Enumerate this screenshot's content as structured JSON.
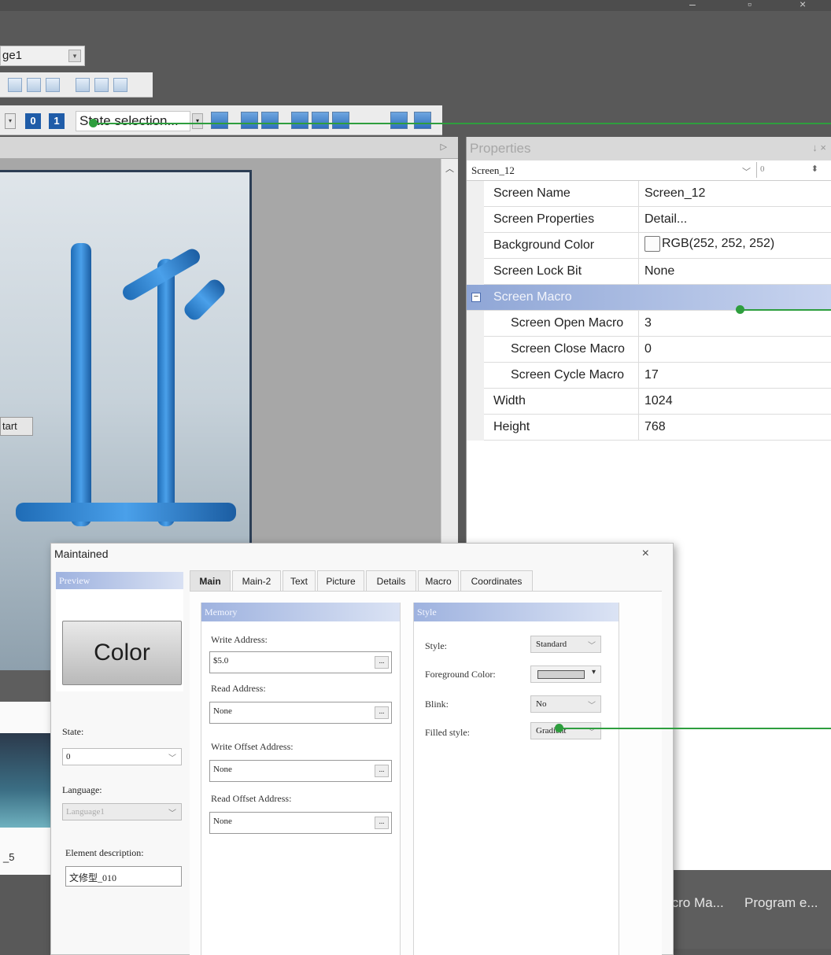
{
  "toolbar": {
    "page_combo_value": "ge1",
    "bit0_label": "0",
    "bit1_label": "1",
    "state_selection_text": "State selection..."
  },
  "canvas": {
    "start_button_label": "tart"
  },
  "thumbnail": {
    "label": "_5"
  },
  "properties": {
    "title": "Properties",
    "pin_icons": "↓ ×",
    "selector_value": "Screen_12",
    "selector_index": "0",
    "rows": [
      {
        "name": "Screen Name",
        "value": "Screen_12"
      },
      {
        "name": "Screen Properties",
        "value": "Detail..."
      },
      {
        "name": "Background Color",
        "value": "RGB(252, 252, 252)"
      },
      {
        "name": "Screen Lock Bit",
        "value": "None"
      }
    ],
    "category": {
      "name": "Screen Macro",
      "toggle": "−"
    },
    "macro_rows": [
      {
        "name": "Screen Open Macro",
        "value": "3"
      },
      {
        "name": "Screen Close Macro",
        "value": "0"
      },
      {
        "name": "Screen Cycle Macro",
        "value": "17"
      }
    ],
    "size_rows": [
      {
        "name": "Width",
        "value": "1024"
      },
      {
        "name": "Height",
        "value": "768"
      }
    ]
  },
  "bottom_tabs": [
    "Macro Ma...",
    "Program e..."
  ],
  "dialog": {
    "title": "Maintained",
    "close_label": "×",
    "preview_header": "Preview",
    "preview_button_text": "Color",
    "state_label": "State:",
    "state_value": "0",
    "language_label": "Language:",
    "language_value": "Language1",
    "element_description_label": "Element description:",
    "element_description_value": "文修型_010",
    "tabs": [
      "Main",
      "Main-2",
      "Text",
      "Picture",
      "Details",
      "Macro",
      "Coordinates"
    ],
    "memory": {
      "header": "Memory",
      "write_address_label": "Write Address:",
      "write_address_value": "$5.0",
      "read_address_label": "Read Address:",
      "read_address_value": "None",
      "write_offset_label": "Write Offset Address:",
      "write_offset_value": "None",
      "read_offset_label": "Read Offset Address:",
      "read_offset_value": "None",
      "browse_label": "..."
    },
    "style": {
      "header": "Style",
      "style_label": "Style:",
      "style_value": "Standard",
      "foreground_label": "Foreground Color:",
      "blink_label": "Blink:",
      "blink_value": "No",
      "filled_label": "Filled style:",
      "filled_value": "Gradient"
    }
  },
  "colors": {
    "annotation_green": "#2e9e3e",
    "bit_button_blue": "#1f5ca8",
    "category_header": "#8fa6d6"
  }
}
